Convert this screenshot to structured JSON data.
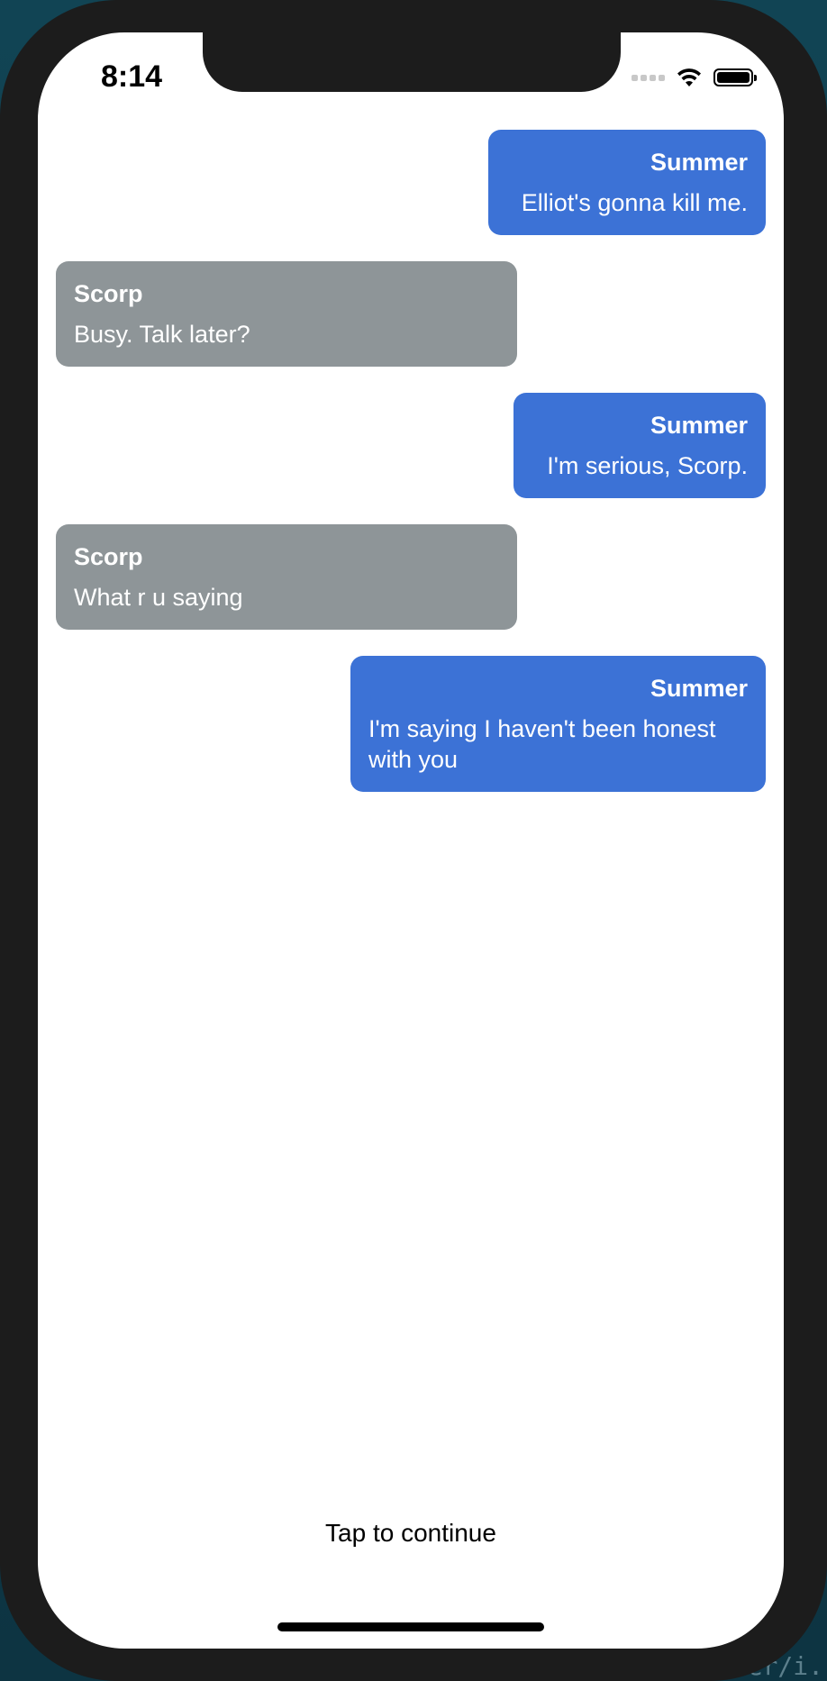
{
  "status_bar": {
    "time": "8:14"
  },
  "messages": [
    {
      "sender": "Summer",
      "text": "Elliot's gonna kill me.",
      "side": "right"
    },
    {
      "sender": "Scorp",
      "text": "Busy. Talk later?",
      "side": "left"
    },
    {
      "sender": "Summer",
      "text": "I'm serious, Scorp.",
      "side": "right"
    },
    {
      "sender": "Scorp",
      "text": "What r u saying",
      "side": "left"
    },
    {
      "sender": "Summer",
      "text": "I'm saying I haven't been honest with you",
      "side": "right"
    }
  ],
  "footer": {
    "continue_label": "Tap to continue"
  },
  "backdrop": {
    "code_snippet": "ner/i."
  },
  "colors": {
    "mine_bubble": "#3c72d6",
    "theirs_bubble": "#8e9598",
    "device_frame": "#1c1c1c"
  }
}
